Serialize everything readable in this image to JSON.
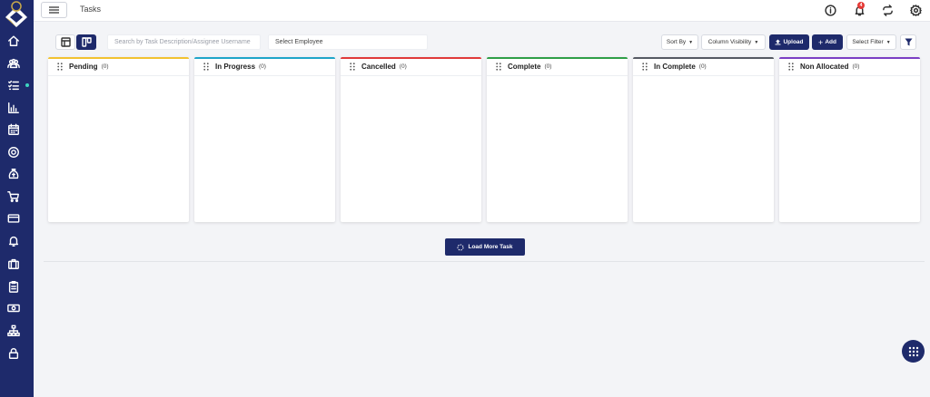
{
  "header": {
    "title": "Tasks",
    "notification_count": "4"
  },
  "sidebar": {
    "items": [
      {
        "icon": "home-icon"
      },
      {
        "icon": "users-icon"
      },
      {
        "icon": "task-list-icon"
      },
      {
        "icon": "bar-chart-icon"
      },
      {
        "icon": "calendar-icon"
      },
      {
        "icon": "target-icon"
      },
      {
        "icon": "money-bag-icon"
      },
      {
        "icon": "cart-icon"
      },
      {
        "icon": "credit-card-icon"
      },
      {
        "icon": "bell-icon"
      },
      {
        "icon": "briefcase-icon"
      },
      {
        "icon": "clipboard-icon"
      },
      {
        "icon": "cash-icon"
      },
      {
        "icon": "org-chart-icon"
      },
      {
        "icon": "lock-icon"
      }
    ]
  },
  "toolbar": {
    "search_placeholder": "Search by Task Description/Assignee Username",
    "employee_select": "Select Employee",
    "sort_by": "Sort By",
    "column_visibility": "Column Visibility",
    "upload": "Upload",
    "add": "Add",
    "select_filter": "Select Filter"
  },
  "columns": [
    {
      "title": "Pending",
      "count": "(0)",
      "color": "#f2c230"
    },
    {
      "title": "In Progress",
      "count": "(0)",
      "color": "#1fa5c9"
    },
    {
      "title": "Cancelled",
      "count": "(0)",
      "color": "#e03a3a"
    },
    {
      "title": "Complete",
      "count": "(0)",
      "color": "#2e9e47"
    },
    {
      "title": "In Complete",
      "count": "(0)",
      "color": "#555a63"
    },
    {
      "title": "Non Allocated",
      "count": "(0)",
      "color": "#7b3fc4"
    }
  ],
  "load_more": "Load More Task",
  "colors": {
    "primary": "#1e2a6b",
    "accent_dot": "#3ed6c0",
    "badge": "#e53935"
  }
}
